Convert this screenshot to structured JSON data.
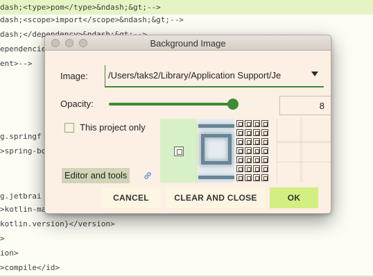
{
  "editor": {
    "lines": [
      {
        "pre": "dash;<type>pom</type>&ndash;&gt;-->",
        "highlighted": true
      },
      {
        "pre": "dash;<scope>import</scope>&ndash;&gt;-->",
        "highlighted": false
      },
      {
        "pre": "dash;</dependency>&ndash;&gt;-->",
        "highlighted": false
      },
      {
        "pre": "ependencies",
        "highlighted": false
      },
      {
        "pre": "ent>-->",
        "highlighted": false
      },
      {
        "pre": "g.springf",
        "highlighted": false
      },
      {
        "pre": ">spring-bo",
        "highlighted": false
      },
      {
        "pre": "g.jetbrai",
        "highlighted": false
      },
      {
        "pre": ">kotlin-ma",
        "highlighted": false
      },
      {
        "pre": "kotlin.version}</version>",
        "highlighted": false
      },
      {
        "pre": ">",
        "highlighted": false
      },
      {
        "pre": "ion>",
        "highlighted": false
      },
      {
        "pre": ">compile</id>",
        "highlighted": false
      }
    ]
  },
  "dialog": {
    "title": "Background Image",
    "image_label": "Image:",
    "image_path": "/Users/taks2/Library/Application Support/Je",
    "opacity_label": "Opacity:",
    "opacity_value": "8",
    "opacity_level": 0.8,
    "this_project_only_label": "This project only",
    "this_project_only_checked": false,
    "editor_and_tools_label": "Editor and tools",
    "buttons": {
      "cancel": "CANCEL",
      "clear_and_close": "CLEAR AND CLOSE",
      "ok": "OK"
    }
  },
  "colors": {
    "accent": "#3e8a35",
    "ok_button": "#d4ef81",
    "dialog_bg": "#fcefe3",
    "highlight_line": "#e6f3c4"
  },
  "icons": {
    "combo_arrow": "chevron-down-icon",
    "link": "link-icon"
  }
}
